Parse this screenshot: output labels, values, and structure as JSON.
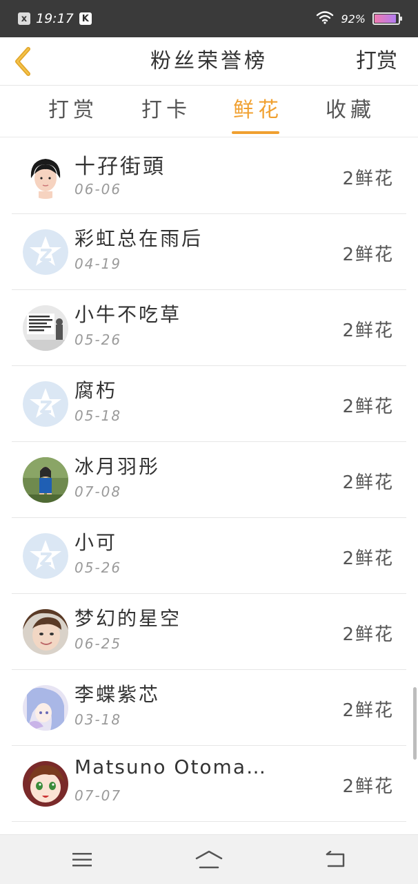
{
  "status_bar": {
    "time": "19:17",
    "badge_x": "x",
    "badge_k": "K",
    "battery": "92%",
    "battery_level": 0.92,
    "icons": [
      "notification-x-icon",
      "k-app-icon",
      "wifi-icon",
      "battery-icon"
    ]
  },
  "header": {
    "title": "粉丝荣誉榜",
    "action": "打赏",
    "back_icon": "chevron-left-icon",
    "accent_color": "#f0a030"
  },
  "tabs": [
    {
      "label": "打赏",
      "active": false
    },
    {
      "label": "打卡",
      "active": false
    },
    {
      "label": "鲜花",
      "active": true
    },
    {
      "label": "收藏",
      "active": false
    }
  ],
  "list": {
    "rows": [
      {
        "name": "十孖街頭",
        "date": "06-06",
        "amount": "2鲜花",
        "avatar": "person-avatar"
      },
      {
        "name": "彩虹总在雨后",
        "date": "04-19",
        "amount": "2鲜花",
        "avatar": "default-star-avatar"
      },
      {
        "name": "小牛不吃草",
        "date": "05-26",
        "amount": "2鲜花",
        "avatar": "photo-avatar"
      },
      {
        "name": "腐朽",
        "date": "05-18",
        "amount": "2鲜花",
        "avatar": "default-star-avatar"
      },
      {
        "name": "冰月羽彤",
        "date": "07-08",
        "amount": "2鲜花",
        "avatar": "photo-avatar"
      },
      {
        "name": "小可",
        "date": "05-26",
        "amount": "2鲜花",
        "avatar": "default-star-avatar"
      },
      {
        "name": "梦幻的星空",
        "date": "06-25",
        "amount": "2鲜花",
        "avatar": "photo-avatar"
      },
      {
        "name": "李蝶紫芯",
        "date": "03-18",
        "amount": "2鲜花",
        "avatar": "anime-avatar"
      },
      {
        "name": "Matsuno Otoma…",
        "date": "07-07",
        "amount": "2鲜花",
        "avatar": "anime-avatar"
      }
    ]
  },
  "nav_bar": {
    "icons": [
      "menu-icon",
      "home-icon",
      "back-icon"
    ]
  }
}
